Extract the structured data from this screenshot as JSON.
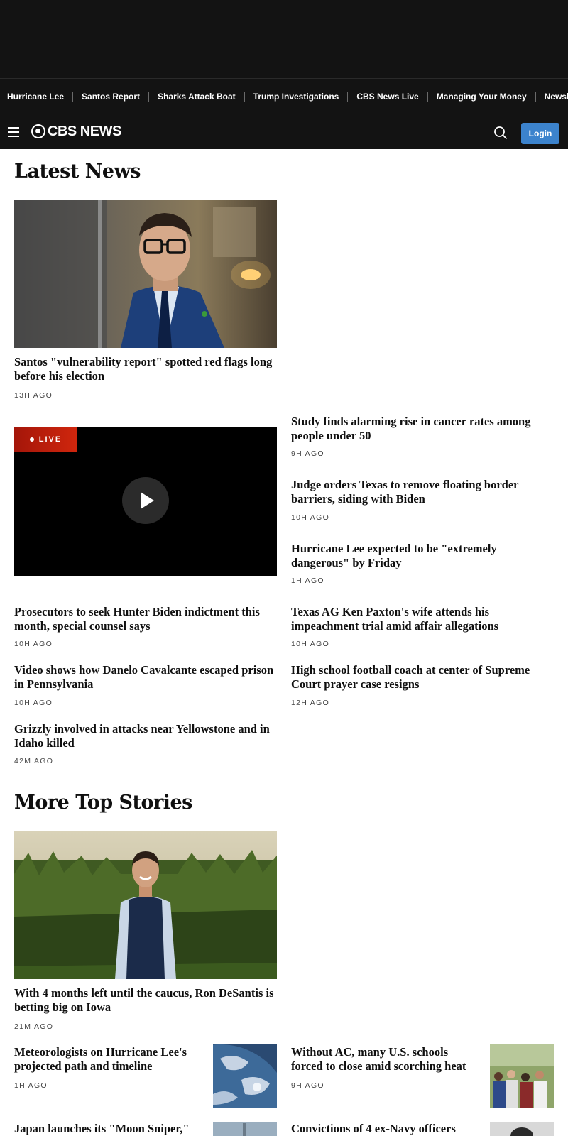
{
  "trending": [
    "Hurricane Lee",
    "Santos Report",
    "Sharks Attack Boat",
    "Trump Investigations",
    "CBS News Live",
    "Managing Your Money",
    "Newsletters"
  ],
  "header": {
    "logo_text": "CBS NEWS",
    "login_label": "Login"
  },
  "latest": {
    "title": "Latest News",
    "lead": {
      "headline": "Santos \"vulnerability report\" spotted red flags long before his election",
      "time": "13H AGO"
    },
    "live_label": "LIVE",
    "right_stories": [
      {
        "headline": "Study finds alarming rise in cancer rates among people under 50",
        "time": "9H AGO"
      },
      {
        "headline": "Judge orders Texas to remove floating border barriers, siding with Biden",
        "time": "10H AGO"
      },
      {
        "headline": "Hurricane Lee expected to be \"extremely dangerous\" by Friday",
        "time": "1H AGO"
      }
    ],
    "grid_stories": [
      {
        "headline": "Prosecutors to seek Hunter Biden indictment this month, special counsel says",
        "time": "10H AGO"
      },
      {
        "headline": "Texas AG Ken Paxton's wife attends his impeachment trial amid affair allegations",
        "time": "10H AGO"
      },
      {
        "headline": "Video shows how Danelo Cavalcante escaped prison in Pennsylvania",
        "time": "10H AGO"
      },
      {
        "headline": "High school football coach at center of Supreme Court prayer case resigns",
        "time": "12H AGO"
      },
      {
        "headline": "Grizzly involved in attacks near Yellowstone and in Idaho killed",
        "time": "42M AGO"
      }
    ]
  },
  "top": {
    "title": "More Top Stories",
    "lead": {
      "headline": "With 4 months left until the caucus, Ron DeSantis is betting big on Iowa",
      "time": "21M AGO"
    },
    "stories": [
      {
        "headline": "Meteorologists on Hurricane Lee's projected path and timeline",
        "time": "1H AGO"
      },
      {
        "headline": "Without AC, many U.S. schools forced to close amid scorching heat",
        "time": "9H AGO"
      },
      {
        "headline": "Japan launches its \"Moon Sniper,\""
      },
      {
        "headline": "Convictions of 4 ex-Navy officers"
      }
    ]
  }
}
